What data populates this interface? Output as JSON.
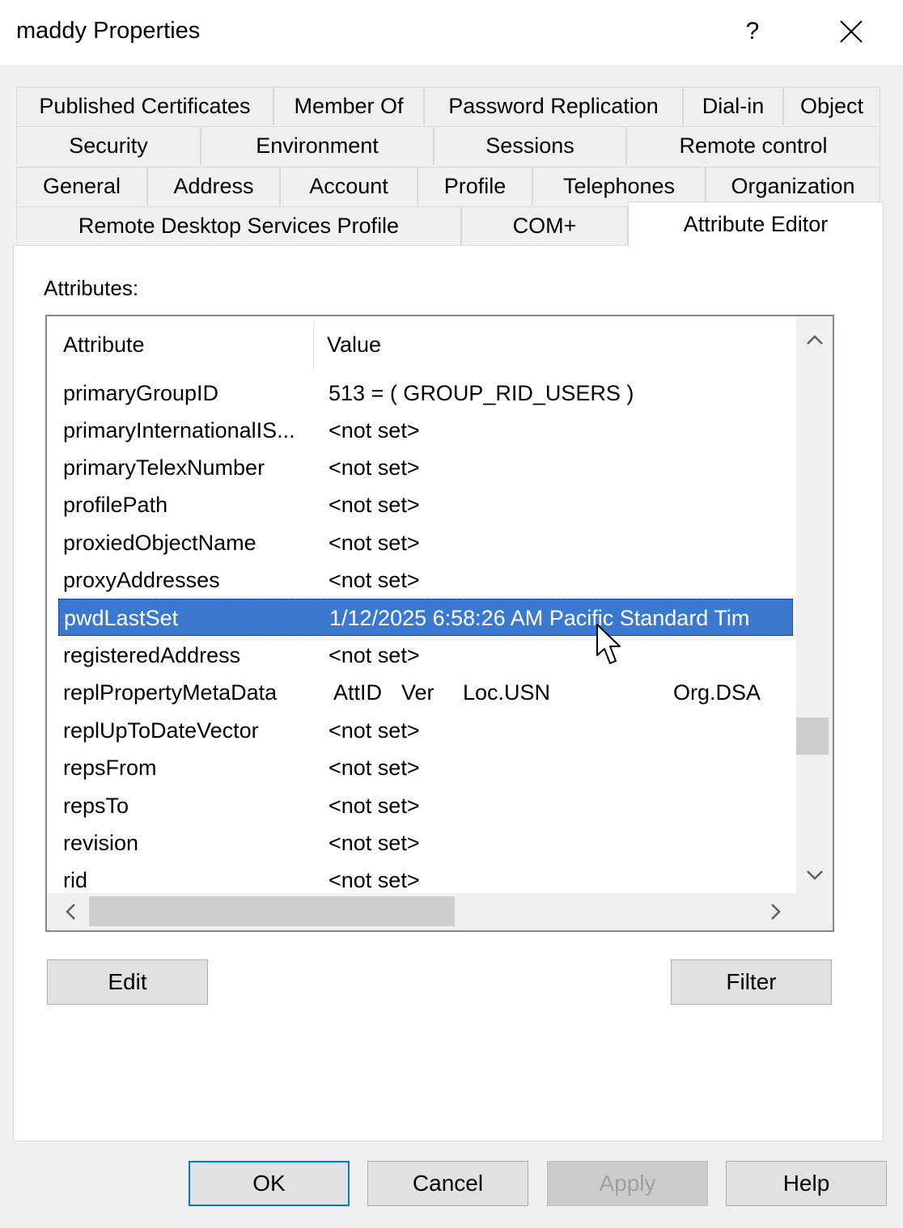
{
  "window": {
    "title": "maddy Properties"
  },
  "tabs": {
    "row1": [
      {
        "label": "Published Certificates"
      },
      {
        "label": "Member Of"
      },
      {
        "label": "Password Replication"
      },
      {
        "label": "Dial-in"
      },
      {
        "label": "Object"
      }
    ],
    "row2": [
      {
        "label": "Security"
      },
      {
        "label": "Environment"
      },
      {
        "label": "Sessions"
      },
      {
        "label": "Remote control"
      }
    ],
    "row3": [
      {
        "label": "General"
      },
      {
        "label": "Address"
      },
      {
        "label": "Account"
      },
      {
        "label": "Profile"
      },
      {
        "label": "Telephones"
      },
      {
        "label": "Organization"
      }
    ],
    "row4": [
      {
        "label": "Remote Desktop Services Profile"
      },
      {
        "label": "COM+"
      },
      {
        "label": "Attribute Editor"
      }
    ],
    "active": "Attribute Editor"
  },
  "attributes": {
    "label": "Attributes:",
    "columns": [
      "Attribute",
      "Value"
    ],
    "rows": [
      {
        "attribute": "primaryGroupID",
        "value": "513 = ( GROUP_RID_USERS )"
      },
      {
        "attribute": "primaryInternationalIS...",
        "value": "<not set>"
      },
      {
        "attribute": "primaryTelexNumber",
        "value": "<not set>"
      },
      {
        "attribute": "profilePath",
        "value": "<not set>"
      },
      {
        "attribute": "proxiedObjectName",
        "value": "<not set>"
      },
      {
        "attribute": "proxyAddresses",
        "value": "<not set>"
      },
      {
        "attribute": "pwdLastSet",
        "value": "1/12/2025 6:58:26 AM Pacific Standard Tim",
        "selected": true
      },
      {
        "attribute": "registeredAddress",
        "value": "<not set>"
      },
      {
        "attribute": "replPropertyMetaData",
        "value_cols": [
          "AttID",
          "Ver",
          "Loc.USN",
          "Org.DSA"
        ]
      },
      {
        "attribute": "replUpToDateVector",
        "value": "<not set>"
      },
      {
        "attribute": "repsFrom",
        "value": "<not set>"
      },
      {
        "attribute": "repsTo",
        "value": "<not set>"
      },
      {
        "attribute": "revision",
        "value": "<not set>"
      },
      {
        "attribute": "rid",
        "value": "<not set>"
      }
    ]
  },
  "buttons": {
    "edit": "Edit",
    "filter": "Filter",
    "ok": "OK",
    "cancel": "Cancel",
    "apply": "Apply",
    "help": "Help"
  },
  "titlebar": {
    "help_glyph": "?"
  },
  "colors": {
    "selection": "#3b79d1",
    "default_button_border": "#0078d7"
  },
  "icons": {
    "close": "close-icon",
    "scroll_up": "chevron-up-icon",
    "scroll_down": "chevron-down-icon",
    "scroll_left": "chevron-left-icon",
    "scroll_right": "chevron-right-icon",
    "cursor": "mouse-pointer-icon"
  }
}
